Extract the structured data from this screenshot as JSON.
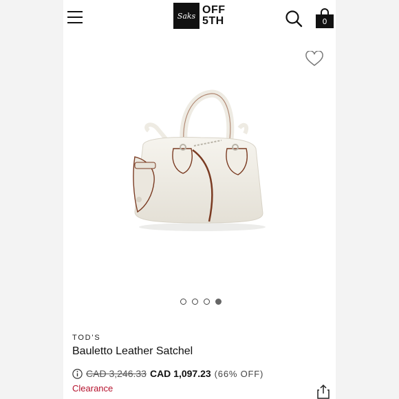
{
  "header": {
    "logo_mark": "Saks",
    "logo_line1": "OFF",
    "logo_line2": "5TH",
    "bag_count": "0"
  },
  "carousel": {
    "slide_count": 4,
    "active_index": 3
  },
  "product": {
    "brand": "TOD'S",
    "name": "Bauletto Leather Satchel",
    "original_price": "CAD 3,246.33",
    "sale_price": "CAD 1,097.23",
    "discount": "(66% OFF)",
    "badge": "Clearance"
  },
  "colors": {
    "accent_red": "#b5122d",
    "logo_bg": "#111111",
    "bag_leather": "#efece4",
    "bag_trim": "#7a3b22"
  },
  "icons": [
    "hamburger-menu-icon",
    "search-icon",
    "shopping-bag-icon",
    "heart-icon",
    "info-icon",
    "share-icon"
  ]
}
